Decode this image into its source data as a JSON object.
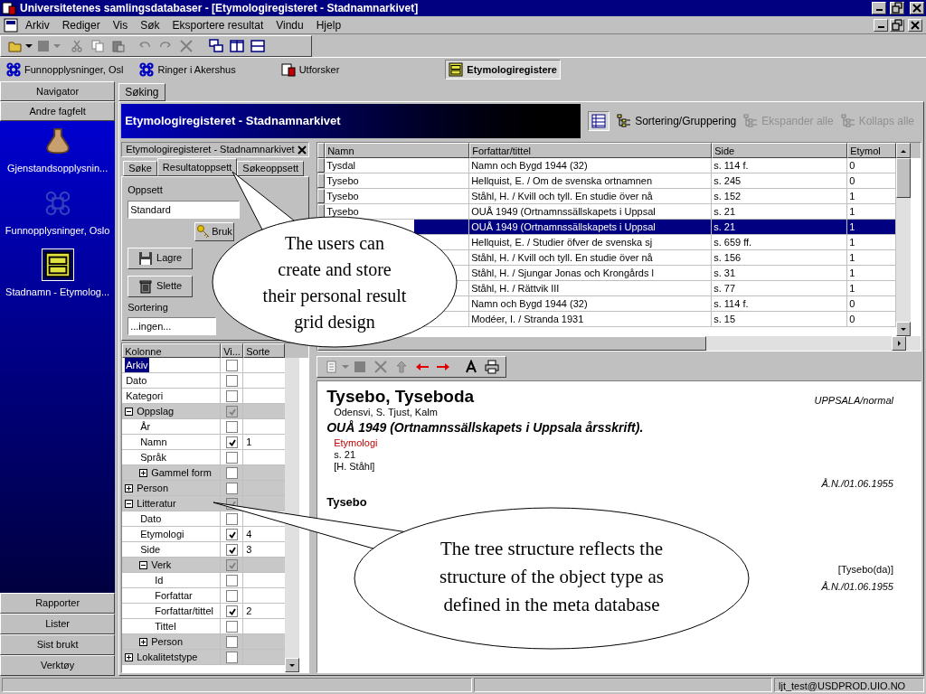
{
  "window": {
    "title": "Universitetenes samlingsdatabaser - [Etymologiregisteret - Stadnamnarkivet]"
  },
  "menu": [
    "Arkiv",
    "Rediger",
    "Vis",
    "Søk",
    "Eksportere resultat",
    "Vindu",
    "Hjelp"
  ],
  "doc_tabs": [
    {
      "label": "Funnopplysninger, Osl",
      "selected": false
    },
    {
      "label": "Ringer i Akershus",
      "selected": false
    },
    {
      "label": "Utforsker",
      "selected": false
    },
    {
      "label": "Etymologiregistere",
      "selected": true
    }
  ],
  "navigator": {
    "title": "Navigator",
    "group": "Andre fagfelt",
    "items": [
      {
        "label": "Gjenstandsopplysnin...",
        "selected": false
      },
      {
        "label": "Funnopplysninger, Oslo",
        "selected": false
      },
      {
        "label": "Stadnamn - Etymolog...",
        "selected": true
      }
    ],
    "bottom": [
      "Rapporter",
      "Lister",
      "Sist brukt",
      "Verktøy"
    ]
  },
  "page_tab": "Søking",
  "header": {
    "title": "Etymologiregisteret - Stadnamnarkivet",
    "buttons": [
      {
        "label": "Sortering/Gruppering",
        "disabled": false
      },
      {
        "label": "Ekspander alle",
        "disabled": true
      },
      {
        "label": "Kollaps alle",
        "disabled": true
      }
    ]
  },
  "search_panel": {
    "title": "Etymologiregisteret - Stadnamnarkivet",
    "tabs": [
      {
        "label": "Søke",
        "selected": false
      },
      {
        "label": "Resultatoppsett",
        "selected": true
      },
      {
        "label": "Søkeoppsett",
        "selected": false
      }
    ],
    "layout_label": "Oppsett",
    "layout_value": "Standard",
    "apply_button": "Bruk",
    "save_button": "Lagre",
    "delete_button": "Slette",
    "sort_label": "Sortering",
    "sort_value": "...ingen...",
    "columns": [
      "Kolonne",
      "Vi...",
      "Sorte"
    ],
    "tree": [
      {
        "label": "Arkiv",
        "kind": "field",
        "checked": false,
        "selected": true
      },
      {
        "label": "Dato",
        "kind": "field",
        "checked": false,
        "selected": false
      },
      {
        "label": "Kategori",
        "kind": "field",
        "checked": false,
        "selected": false
      },
      {
        "label": "Oppslag",
        "kind": "group",
        "expanded": true,
        "checked": true,
        "selected": false,
        "children": [
          {
            "label": "År",
            "kind": "field",
            "checked": false,
            "selected": false
          },
          {
            "label": "Namn",
            "kind": "field",
            "checked": true,
            "sort": "1",
            "selected": false
          },
          {
            "label": "Språk",
            "kind": "field",
            "checked": false,
            "selected": false
          },
          {
            "label": "Gammel form",
            "kind": "group",
            "expanded": false,
            "checked": false,
            "selected": false
          }
        ]
      },
      {
        "label": "Person",
        "kind": "group",
        "expanded": false,
        "checked": false,
        "selected": false
      },
      {
        "label": "Litteratur",
        "kind": "group",
        "expanded": true,
        "checked": true,
        "selected": false,
        "children": [
          {
            "label": "Dato",
            "kind": "field",
            "checked": false,
            "selected": false
          },
          {
            "label": "Etymologi",
            "kind": "field",
            "checked": true,
            "sort": "4",
            "selected": false
          },
          {
            "label": "Side",
            "kind": "field",
            "checked": true,
            "sort": "3",
            "selected": false
          },
          {
            "label": "Verk",
            "kind": "group",
            "expanded": true,
            "checked": true,
            "selected": false,
            "children": [
              {
                "label": "Id",
                "kind": "field",
                "checked": false,
                "selected": false
              },
              {
                "label": "Forfattar",
                "kind": "field",
                "checked": false,
                "selected": false
              },
              {
                "label": "Forfattar/tittel",
                "kind": "field",
                "checked": true,
                "sort": "2",
                "selected": false
              },
              {
                "label": "Tittel",
                "kind": "field",
                "checked": false,
                "selected": false
              }
            ]
          },
          {
            "label": "Person",
            "kind": "group",
            "expanded": false,
            "checked": false,
            "selected": false
          }
        ]
      },
      {
        "label": "Lokalitetstype",
        "kind": "group",
        "expanded": false,
        "checked": false,
        "selected": false
      }
    ]
  },
  "table": {
    "columns": [
      "Namn",
      "Forfattar/tittel",
      "Side",
      "Etymol"
    ],
    "rows": [
      {
        "namn": "Tysdal",
        "forfattar": "Namn och Bygd 1944 (32)",
        "side": "s. 114 f.",
        "etymol": "0",
        "selected": false
      },
      {
        "namn": "Tysebo",
        "forfattar": "Hellquist, E. / Om de svenska ortnamnen",
        "side": "s. 245",
        "etymol": "0",
        "selected": false
      },
      {
        "namn": "Tysebo",
        "forfattar": "Ståhl, H. / Kvill och tyll. En studie över nå",
        "side": "s. 152",
        "etymol": "1",
        "selected": false
      },
      {
        "namn": "Tysebo",
        "forfattar": "OUÅ 1949 (Ortnamnssällskapets i Uppsal",
        "side": "s. 21",
        "etymol": "1",
        "selected": false
      },
      {
        "forfattar": "OUÅ 1949 (Ortnamnssällskapets i Uppsal",
        "side": "s. 21",
        "etymol": "1",
        "selected": true
      },
      {
        "forfattar": "Hellquist, E. / Studier öfver de svenska sj",
        "side": "s. 659 ff.",
        "etymol": "1",
        "selected": false
      },
      {
        "forfattar": "Ståhl, H. / Kvill och tyll. En studie över nå",
        "side": "s. 156",
        "etymol": "1",
        "selected": false
      },
      {
        "forfattar": "Ståhl, H. / Sjungar Jonas och Krongårds l",
        "side": "s. 31",
        "etymol": "1",
        "selected": false
      },
      {
        "forfattar": "Ståhl, H. / Rättvik III",
        "side": "s. 77",
        "etymol": "1",
        "selected": false
      },
      {
        "forfattar": "Namn och Bygd 1944 (32)",
        "side": "s. 114 f.",
        "etymol": "0",
        "selected": false
      },
      {
        "forfattar": "Modéer, I. / Stranda 1931",
        "side": "s. 15",
        "etymol": "0",
        "selected": false
      }
    ]
  },
  "document": {
    "title": "Tysebo, Tyseboda",
    "region": "UPPSALA/normal",
    "place": "Odensvi, S. Tjust, Kalm",
    "source": "OUÅ 1949 (Ortnamnssällskapets i Uppsala årsskrift).",
    "section": "Etymologi",
    "page": "s. 21",
    "author": "[H. Ståhl]",
    "stamp": "Å.N./01.06.1955",
    "subheading": "Tysebo",
    "ref": "[Tysebo(da)]",
    "stamp2": "Å.N./01.06.1955"
  },
  "callouts": [
    "The users can create and store their personal result grid design",
    "The tree structure reflects the structure of the object type as defined in the meta database"
  ],
  "status_bar": {
    "user": "ljt_test@USDPROD.UIO.NO"
  }
}
